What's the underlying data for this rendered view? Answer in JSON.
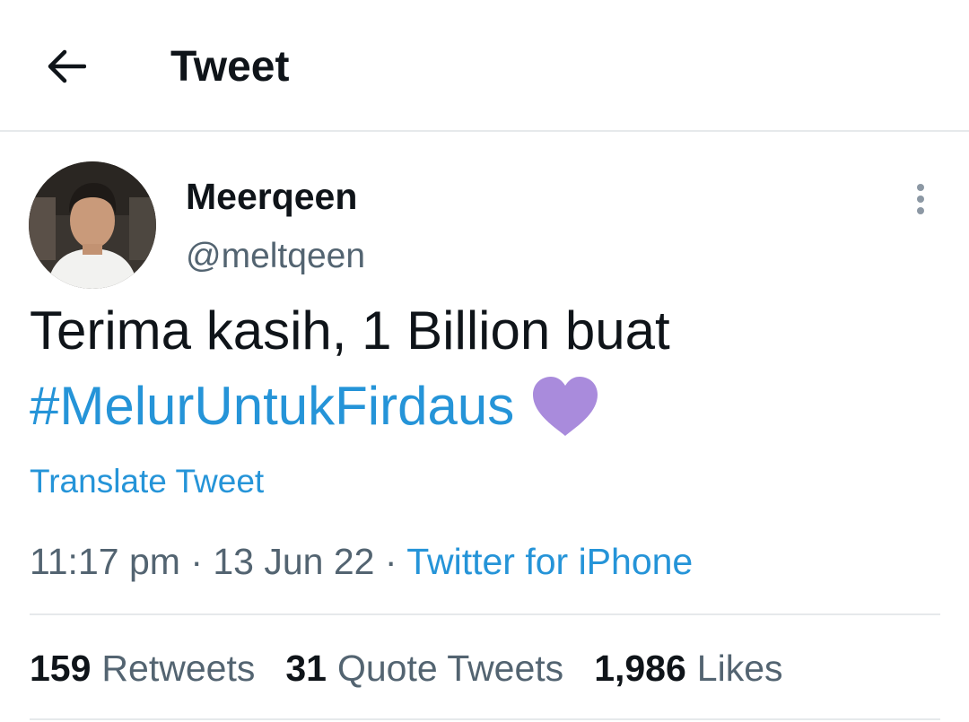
{
  "header": {
    "back_icon": "arrow-left-icon",
    "title": "Tweet"
  },
  "tweet": {
    "author": {
      "display_name": "Meerqeen",
      "handle": "@meltqeen",
      "avatar_icon": "avatar-photo"
    },
    "more_icon": "more-vertical-icon",
    "text_line1": "Terima kasih, 1 Billion buat",
    "hashtag": "#MelurUntukFirdaus",
    "emoji": "purple-heart",
    "translate_label": "Translate Tweet",
    "time": "11:17 pm",
    "separator": "·",
    "date": "13 Jun 22",
    "source": "Twitter for iPhone"
  },
  "stats": {
    "retweets_count": "159",
    "retweets_label": "Retweets",
    "quotes_count": "31",
    "quotes_label": "Quote Tweets",
    "likes_count": "1,986",
    "likes_label": "Likes"
  },
  "colors": {
    "link": "#2594d8",
    "secondary_text": "#536471",
    "primary_text": "#0f1419",
    "heart": "#a98bdc",
    "divider": "#e6e9eb"
  }
}
